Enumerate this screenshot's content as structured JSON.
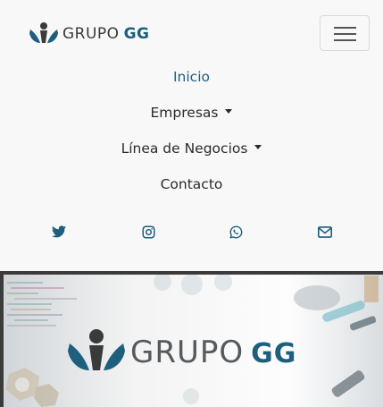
{
  "brand": {
    "word": "GRUPO",
    "accent": "GG"
  },
  "nav": {
    "items": [
      {
        "label": "Inicio",
        "active": true,
        "dropdown": false
      },
      {
        "label": "Empresas",
        "active": false,
        "dropdown": true
      },
      {
        "label": "Línea de Negocios",
        "active": false,
        "dropdown": true
      },
      {
        "label": "Contacto",
        "active": false,
        "dropdown": false
      }
    ]
  },
  "social": [
    "twitter-icon",
    "instagram-icon",
    "whatsapp-icon",
    "envelope-icon"
  ],
  "hero": {
    "word": "GRUPO",
    "accent": "GG"
  },
  "colors": {
    "accent": "#1d5f7c",
    "text": "#2b2b2b",
    "background": "#f8f8f8"
  }
}
